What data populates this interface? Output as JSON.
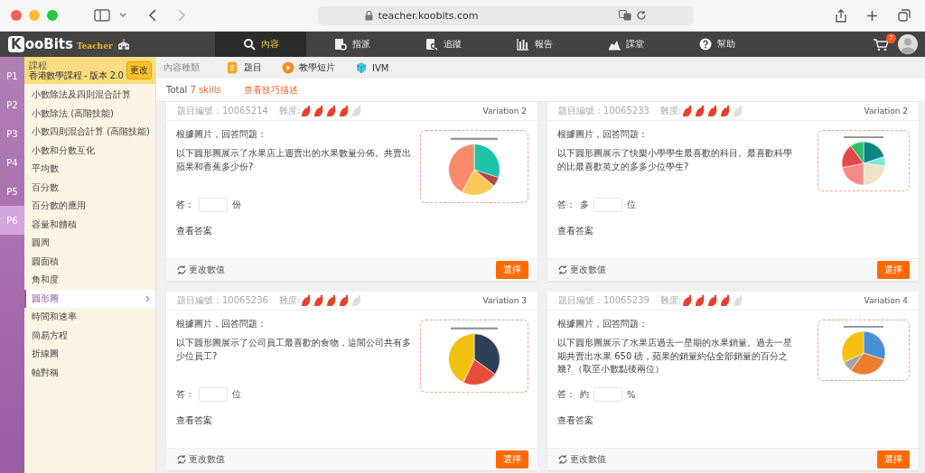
{
  "browser": {
    "url": "teacher.koobits.com"
  },
  "app_bar": {
    "logo": "KooBits",
    "logo_suffix": "Teacher",
    "cart_count": "7",
    "nav": [
      {
        "label": "內容",
        "selected": true
      },
      {
        "label": "指派",
        "selected": false
      },
      {
        "label": "追蹤",
        "selected": false
      },
      {
        "label": "報告",
        "selected": false
      },
      {
        "label": "課堂",
        "selected": false
      },
      {
        "label": "幫助",
        "selected": false
      }
    ]
  },
  "grades": [
    {
      "label": "P1",
      "selected": false
    },
    {
      "label": "P2",
      "selected": false
    },
    {
      "label": "P3",
      "selected": false
    },
    {
      "label": "P4",
      "selected": false
    },
    {
      "label": "P5",
      "selected": false
    },
    {
      "label": "P6",
      "selected": true
    }
  ],
  "course": {
    "caption": "課程",
    "name": "香港數學課程 - 版本 2.0",
    "change_button": "更改"
  },
  "topics": [
    {
      "label": "小數除法及四則混合計算",
      "selected": false
    },
    {
      "label": "小數除法 (高階技能)",
      "selected": false
    },
    {
      "label": "小數四則混合計算 (高階技能)",
      "selected": false
    },
    {
      "label": "小數和分數互化",
      "selected": false
    },
    {
      "label": "平均數",
      "selected": false
    },
    {
      "label": "百分數",
      "selected": false
    },
    {
      "label": "百分數的應用",
      "selected": false
    },
    {
      "label": "容量和體積",
      "selected": false
    },
    {
      "label": "圓周",
      "selected": false
    },
    {
      "label": "圓面積",
      "selected": false
    },
    {
      "label": "角和度",
      "selected": false
    },
    {
      "label": "圓形圖",
      "selected": true
    },
    {
      "label": "時間和速率",
      "selected": false
    },
    {
      "label": "簡易方程",
      "selected": false
    },
    {
      "label": "折線圖",
      "selected": false
    },
    {
      "label": "軸對稱",
      "selected": false
    }
  ],
  "content_types": {
    "caption": "內容種類",
    "items": [
      {
        "label": "題目"
      },
      {
        "label": "教學短片"
      },
      {
        "label": "IVM"
      }
    ]
  },
  "summary": {
    "total_label": "Total",
    "total_value": "7 skills",
    "link": "查看技巧描述"
  },
  "questions": [
    {
      "id_label": "題目編號：10065214",
      "difficulty_label": "難度:",
      "stars": 4,
      "variation": "Variation 2",
      "prompt": "根據圖片，回答問題：",
      "question": "以下圓形圖展示了水果店上週賣出的水果數量分佈。共賣出蘋果和香蕉多少份?",
      "answer_label": "答：",
      "unit": "份",
      "show_answer": "查看答案",
      "change_values": "更改數值",
      "select_button": "選擇",
      "slices": [
        {
          "color": "#1fc4a8"
        },
        {
          "color": "#b5473f"
        },
        {
          "color": "#fcc85a"
        },
        {
          "color": "#fa8a6c"
        }
      ]
    },
    {
      "id_label": "題目編號：10065233",
      "difficulty_label": "難度:",
      "stars": 4,
      "variation": "Variation 2",
      "prompt": "根據圖片，回答問題：",
      "question": "以下圓形圖展示了快樂小學學生最喜歡的科目。最喜歡科學的比最喜歡英文的多多少位學生?",
      "answer_label": "答：",
      "answer_prefix": "多",
      "unit": "位",
      "show_answer": "查看答案",
      "change_values": "更改數值",
      "select_button": "選擇",
      "slices": [
        {
          "color": "#0e8583"
        },
        {
          "color": "#7ee8d8"
        },
        {
          "color": "#f0e2c8"
        },
        {
          "color": "#f68b86"
        },
        {
          "color": "#e8474a"
        },
        {
          "color": "#2fbf6a"
        }
      ]
    },
    {
      "id_label": "題目編號：10065236",
      "difficulty_label": "難度:",
      "stars": 4,
      "variation": "Variation 3",
      "prompt": "根據圖片，回答問題：",
      "question": "以下圓形圖展示了公司員工最喜歡的食物，這間公司共有多少位員工?",
      "answer_label": "答：",
      "unit": "位",
      "show_answer": "查看答案",
      "change_values": "更改數值",
      "select_button": "選擇",
      "slices": [
        {
          "color": "#2e4057"
        },
        {
          "color": "#e84c3d"
        },
        {
          "color": "#f2c011"
        }
      ]
    },
    {
      "id_label": "題目編號：10065239",
      "difficulty_label": "難度:",
      "stars": 4,
      "variation": "Variation 4",
      "prompt": "根據圖片，回答問題：",
      "question": "以下圓形圖展示了水果店過去一星期的水果銷量。過去一星期共賣出水果 650 磅，蘋果的銷量約佔全部銷量的百分之幾? （取至小數點後兩位）",
      "answer_label": "答：",
      "answer_prefix": "約",
      "unit": "%",
      "show_answer": "查看答案",
      "change_values": "更改數值",
      "select_button": "選擇",
      "slices": [
        {
          "color": "#4a90d9"
        },
        {
          "color": "#ee7d30"
        },
        {
          "color": "#a5a5a5"
        },
        {
          "color": "#f5c00f"
        }
      ]
    }
  ]
}
